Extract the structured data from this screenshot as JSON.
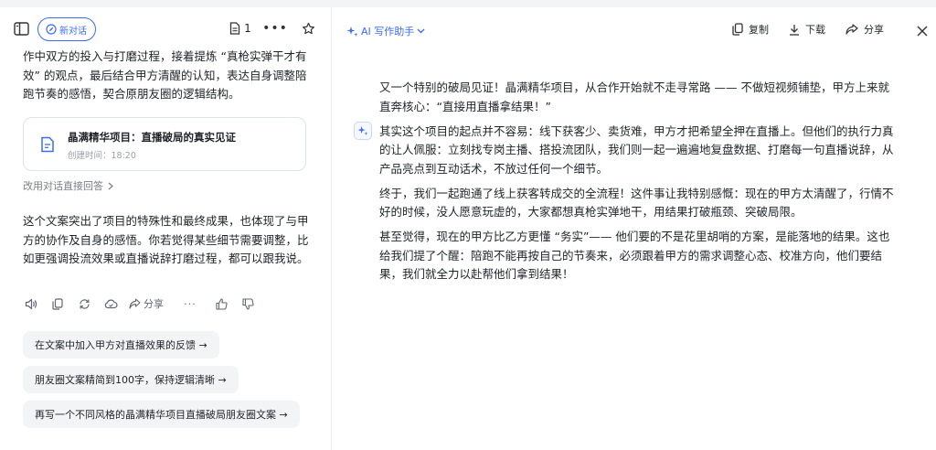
{
  "toolbar": {
    "new_chat_label": "新对话",
    "doc_count": "1"
  },
  "chat": {
    "intro_text": "作中双方的投入与打磨过程，接着提炼 “真枪实弹干才有效” 的观点，最后结合甲方清醒的认知，表达自身调整陪跑节奏的感悟，契合原朋友圈的逻辑结构。",
    "card": {
      "title": "晶满精华项目：直播破局的真实见证",
      "created": "创建时间：18:20"
    },
    "reply_link": "改用对话直接回答",
    "summary_text": "这个文案突出了项目的特殊性和最终成果，也体现了与甲方的协作及自身的感悟。你若觉得某些细节需要调整，比如更强调投流效果或直播说辞打磨过程，都可以跟我说。",
    "actions": {
      "share_label": "分享"
    },
    "suggestions": [
      "在文案中加入甲方对直播效果的反馈 →",
      "朋友圈文案精简到100字，保持逻辑清晰 →",
      "再写一个不同风格的晶满精华项目直播破局朋友圈文案 →"
    ]
  },
  "editor": {
    "ai_menu_label": "AI 写作助手",
    "copy_label": "复制",
    "download_label": "下载",
    "share_label": "分享",
    "paragraphs": [
      "又一个特别的破局见证！晶满精华项目，从合作开始就不走寻常路 —— 不做短视频铺垫，甲方上来就直奔核心：“直接用直播拿结果！”",
      "其实这个项目的起点并不容易：线下获客少、卖货难，甲方才把希望全押在直播上。但他们的执行力真的让人佩服：立刻找专岗主播、搭投流团队，我们则一起一遍遍地复盘数据、打磨每一句直播说辞，从产品亮点到互动话术，不放过任何一个细节。",
      "终于，我们一起跑通了线上获客转成交的全流程！这件事让我特别感慨：现在的甲方太清醒了，行情不好的时候，没人愿意玩虚的，大家都想真枪实弹地干，用结果打破瓶颈、突破局限。",
      "甚至觉得，现在的甲方比乙方更懂 “务实”—— 他们要的不是花里胡哨的方案，是能落地的结果。这也给我们提了个醒：陪跑不能再按自己的节奏来，必须跟着甲方的需求调整心态、校准方向，他们要结果，我们就全力以赴帮他们拿到结果！"
    ]
  },
  "colors": {
    "accent": "#3b6cf6",
    "text": "#1f2329",
    "muted": "#9aa0a6"
  }
}
